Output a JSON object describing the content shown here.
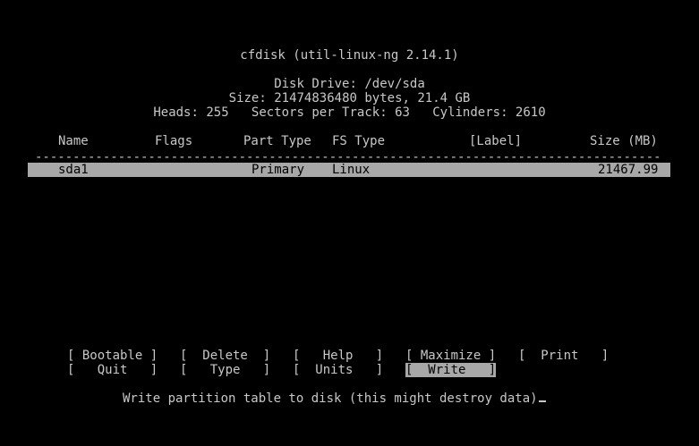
{
  "header": {
    "title": "cfdisk (util-linux-ng 2.14.1)",
    "disk_drive": "Disk Drive: /dev/sda",
    "size": "Size: 21474836480 bytes, 21.4 GB",
    "geometry": "Heads: 255   Sectors per Track: 63   Cylinders: 2610"
  },
  "table": {
    "columns": {
      "name": "Name",
      "flags": "Flags",
      "part_type": "Part Type",
      "fs_type": "FS Type",
      "label": "[Label]",
      "size": "Size (MB)"
    },
    "separator": "---------------------------------------------------------------------------------------",
    "rows": [
      {
        "name": "sda1",
        "flags": "",
        "part_type": "Primary",
        "fs_type": "Linux",
        "label": "",
        "size": "21467.99"
      }
    ]
  },
  "menu": {
    "bootable": "[ Bootable ]",
    "delete": "[  Delete  ]",
    "help": "[   Help   ]",
    "maximize": "[ Maximize ]",
    "print": "[  Print   ]",
    "quit": "[   Quit   ]",
    "type": "[   Type   ]",
    "units": "[  Units   ]",
    "write": "[  Write   ]",
    "selected": "write"
  },
  "status": {
    "message": "Write partition table to disk (this might destroy data)"
  },
  "colors": {
    "background": "#000000",
    "foreground": "#c8c8c8",
    "highlight_bg": "#a8a8a8",
    "highlight_fg": "#000000"
  }
}
